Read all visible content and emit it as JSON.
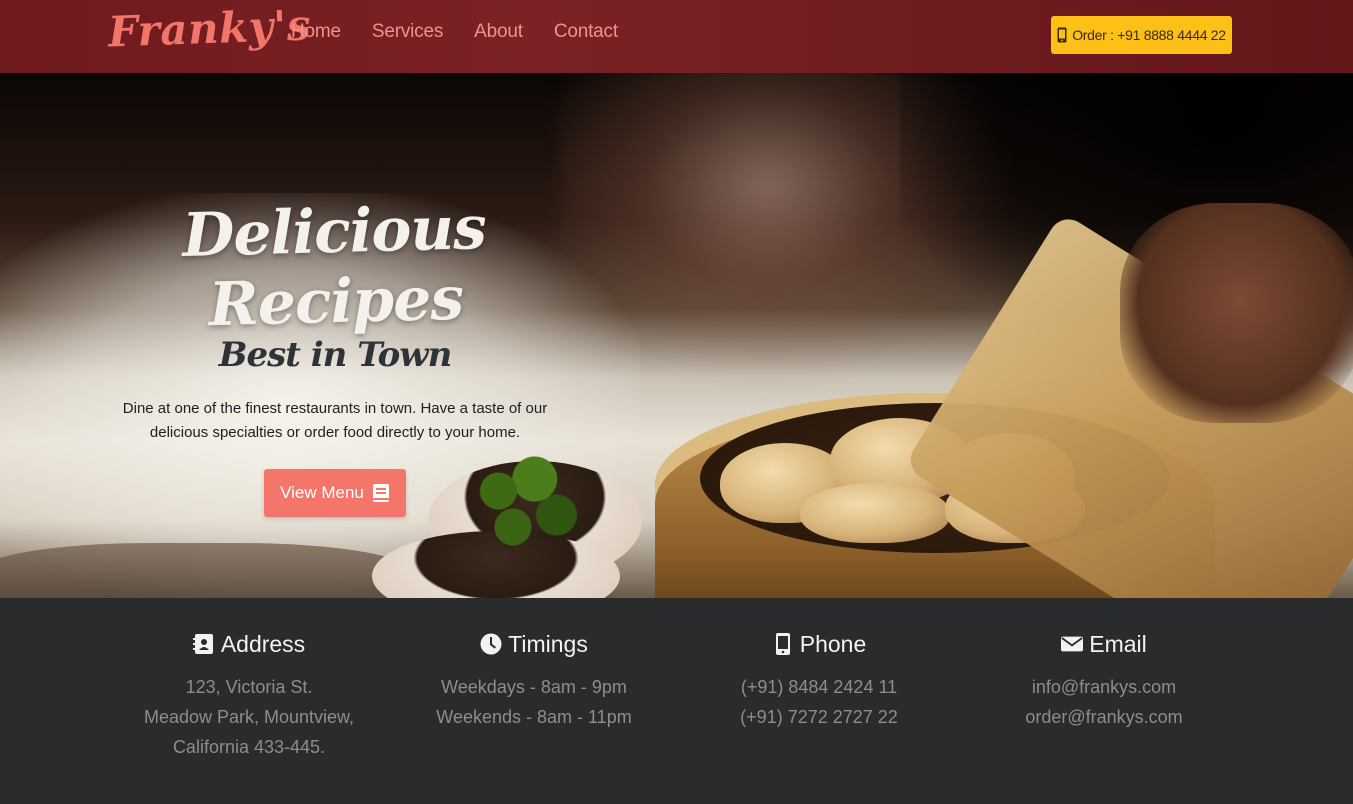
{
  "brand": {
    "logo_text": "Franky's"
  },
  "nav": {
    "links": [
      "Home",
      "Services",
      "About",
      "Contact"
    ],
    "order_label": "Order : +91 8888 4444 22"
  },
  "hero": {
    "title": "Delicious Recipes",
    "subtitle": "Best in Town",
    "description_line1": "Dine at one of the finest restaurants in town. Have a taste of our",
    "description_line2": "delicious specialties or order food directly to your home.",
    "cta_label": "View Menu",
    "cta_icon": "book-icon"
  },
  "info": [
    {
      "icon": "address-book-icon",
      "title": "Address",
      "lines": [
        "123, Victoria St.",
        "Meadow Park, Mountview,",
        "California 433-445."
      ]
    },
    {
      "icon": "clock-icon",
      "title": "Timings",
      "lines": [
        "Weekdays - 8am - 9pm",
        "Weekends - 8am - 11pm"
      ]
    },
    {
      "icon": "mobile-phone-icon",
      "title": "Phone",
      "lines": [
        "(+91) 8484 2424 11",
        "(+91) 7272 2727 22"
      ]
    },
    {
      "icon": "envelope-icon",
      "title": "Email",
      "lines": [
        "info@frankys.com",
        "order@frankys.com"
      ]
    }
  ],
  "colors": {
    "navbar": "#721e22",
    "accent_coral": "#f4766b",
    "order_button": "#fdc017",
    "footer_bg": "#2a2b2c"
  }
}
